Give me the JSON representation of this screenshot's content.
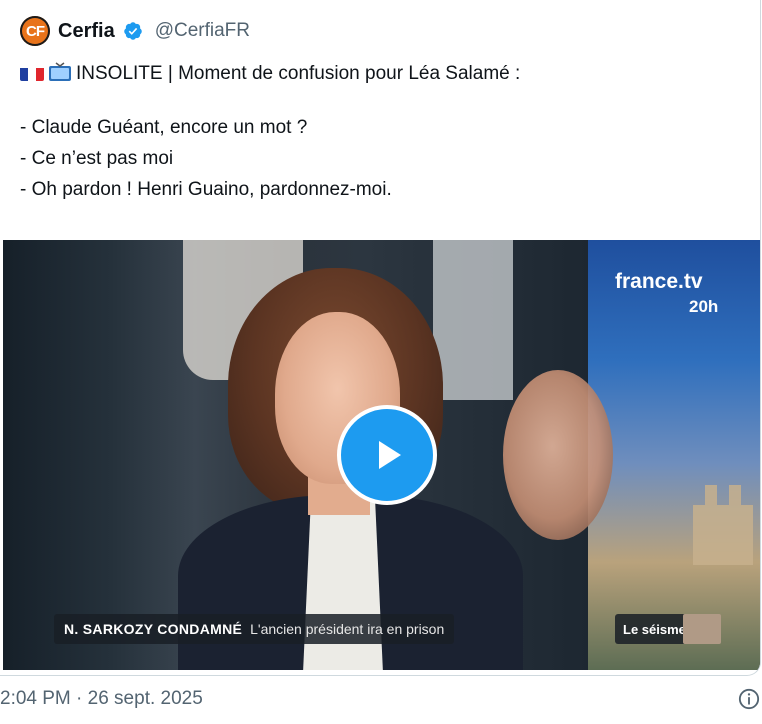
{
  "account": {
    "name": "Cerfia",
    "handle": "@CerfiaFR",
    "logo_letters": "CF",
    "brand_color": "#e8731a",
    "verified_color": "#1d9bf0"
  },
  "post": {
    "headline": "INSOLITE | Moment de confusion pour Léa Salamé :",
    "lines": [
      "- Claude Guéant, encore un mot ?",
      "- Ce n’est pas moi",
      "- Oh pardon ! Henri Guaino, pardonnez-moi."
    ]
  },
  "video": {
    "channel": "france.tv",
    "channel_sub": "20h",
    "banner_title": "N. SARKOZY CONDAMNÉ",
    "banner_subtitle": "L'ancien président ira en prison",
    "side_label": "Le séisme",
    "play_color": "#1d9bf0"
  },
  "footer": {
    "timestamp": "2:04 PM · 26 sept. 2025"
  }
}
